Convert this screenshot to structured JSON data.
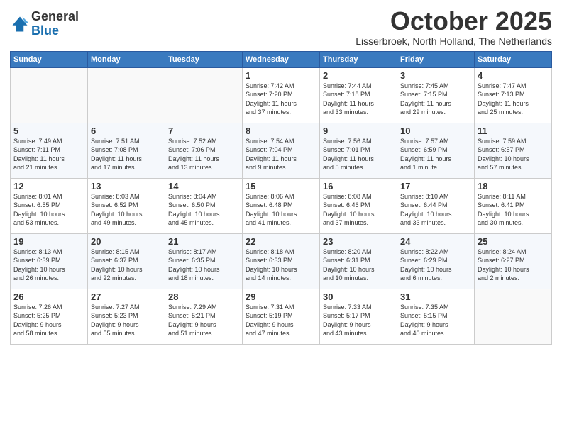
{
  "header": {
    "logo_line1": "General",
    "logo_line2": "Blue",
    "month": "October 2025",
    "location": "Lisserbroek, North Holland, The Netherlands"
  },
  "days_of_week": [
    "Sunday",
    "Monday",
    "Tuesday",
    "Wednesday",
    "Thursday",
    "Friday",
    "Saturday"
  ],
  "weeks": [
    [
      {
        "num": "",
        "info": ""
      },
      {
        "num": "",
        "info": ""
      },
      {
        "num": "",
        "info": ""
      },
      {
        "num": "1",
        "info": "Sunrise: 7:42 AM\nSunset: 7:20 PM\nDaylight: 11 hours\nand 37 minutes."
      },
      {
        "num": "2",
        "info": "Sunrise: 7:44 AM\nSunset: 7:18 PM\nDaylight: 11 hours\nand 33 minutes."
      },
      {
        "num": "3",
        "info": "Sunrise: 7:45 AM\nSunset: 7:15 PM\nDaylight: 11 hours\nand 29 minutes."
      },
      {
        "num": "4",
        "info": "Sunrise: 7:47 AM\nSunset: 7:13 PM\nDaylight: 11 hours\nand 25 minutes."
      }
    ],
    [
      {
        "num": "5",
        "info": "Sunrise: 7:49 AM\nSunset: 7:11 PM\nDaylight: 11 hours\nand 21 minutes."
      },
      {
        "num": "6",
        "info": "Sunrise: 7:51 AM\nSunset: 7:08 PM\nDaylight: 11 hours\nand 17 minutes."
      },
      {
        "num": "7",
        "info": "Sunrise: 7:52 AM\nSunset: 7:06 PM\nDaylight: 11 hours\nand 13 minutes."
      },
      {
        "num": "8",
        "info": "Sunrise: 7:54 AM\nSunset: 7:04 PM\nDaylight: 11 hours\nand 9 minutes."
      },
      {
        "num": "9",
        "info": "Sunrise: 7:56 AM\nSunset: 7:01 PM\nDaylight: 11 hours\nand 5 minutes."
      },
      {
        "num": "10",
        "info": "Sunrise: 7:57 AM\nSunset: 6:59 PM\nDaylight: 11 hours\nand 1 minute."
      },
      {
        "num": "11",
        "info": "Sunrise: 7:59 AM\nSunset: 6:57 PM\nDaylight: 10 hours\nand 57 minutes."
      }
    ],
    [
      {
        "num": "12",
        "info": "Sunrise: 8:01 AM\nSunset: 6:55 PM\nDaylight: 10 hours\nand 53 minutes."
      },
      {
        "num": "13",
        "info": "Sunrise: 8:03 AM\nSunset: 6:52 PM\nDaylight: 10 hours\nand 49 minutes."
      },
      {
        "num": "14",
        "info": "Sunrise: 8:04 AM\nSunset: 6:50 PM\nDaylight: 10 hours\nand 45 minutes."
      },
      {
        "num": "15",
        "info": "Sunrise: 8:06 AM\nSunset: 6:48 PM\nDaylight: 10 hours\nand 41 minutes."
      },
      {
        "num": "16",
        "info": "Sunrise: 8:08 AM\nSunset: 6:46 PM\nDaylight: 10 hours\nand 37 minutes."
      },
      {
        "num": "17",
        "info": "Sunrise: 8:10 AM\nSunset: 6:44 PM\nDaylight: 10 hours\nand 33 minutes."
      },
      {
        "num": "18",
        "info": "Sunrise: 8:11 AM\nSunset: 6:41 PM\nDaylight: 10 hours\nand 30 minutes."
      }
    ],
    [
      {
        "num": "19",
        "info": "Sunrise: 8:13 AM\nSunset: 6:39 PM\nDaylight: 10 hours\nand 26 minutes."
      },
      {
        "num": "20",
        "info": "Sunrise: 8:15 AM\nSunset: 6:37 PM\nDaylight: 10 hours\nand 22 minutes."
      },
      {
        "num": "21",
        "info": "Sunrise: 8:17 AM\nSunset: 6:35 PM\nDaylight: 10 hours\nand 18 minutes."
      },
      {
        "num": "22",
        "info": "Sunrise: 8:18 AM\nSunset: 6:33 PM\nDaylight: 10 hours\nand 14 minutes."
      },
      {
        "num": "23",
        "info": "Sunrise: 8:20 AM\nSunset: 6:31 PM\nDaylight: 10 hours\nand 10 minutes."
      },
      {
        "num": "24",
        "info": "Sunrise: 8:22 AM\nSunset: 6:29 PM\nDaylight: 10 hours\nand 6 minutes."
      },
      {
        "num": "25",
        "info": "Sunrise: 8:24 AM\nSunset: 6:27 PM\nDaylight: 10 hours\nand 2 minutes."
      }
    ],
    [
      {
        "num": "26",
        "info": "Sunrise: 7:26 AM\nSunset: 5:25 PM\nDaylight: 9 hours\nand 58 minutes."
      },
      {
        "num": "27",
        "info": "Sunrise: 7:27 AM\nSunset: 5:23 PM\nDaylight: 9 hours\nand 55 minutes."
      },
      {
        "num": "28",
        "info": "Sunrise: 7:29 AM\nSunset: 5:21 PM\nDaylight: 9 hours\nand 51 minutes."
      },
      {
        "num": "29",
        "info": "Sunrise: 7:31 AM\nSunset: 5:19 PM\nDaylight: 9 hours\nand 47 minutes."
      },
      {
        "num": "30",
        "info": "Sunrise: 7:33 AM\nSunset: 5:17 PM\nDaylight: 9 hours\nand 43 minutes."
      },
      {
        "num": "31",
        "info": "Sunrise: 7:35 AM\nSunset: 5:15 PM\nDaylight: 9 hours\nand 40 minutes."
      },
      {
        "num": "",
        "info": ""
      }
    ]
  ]
}
